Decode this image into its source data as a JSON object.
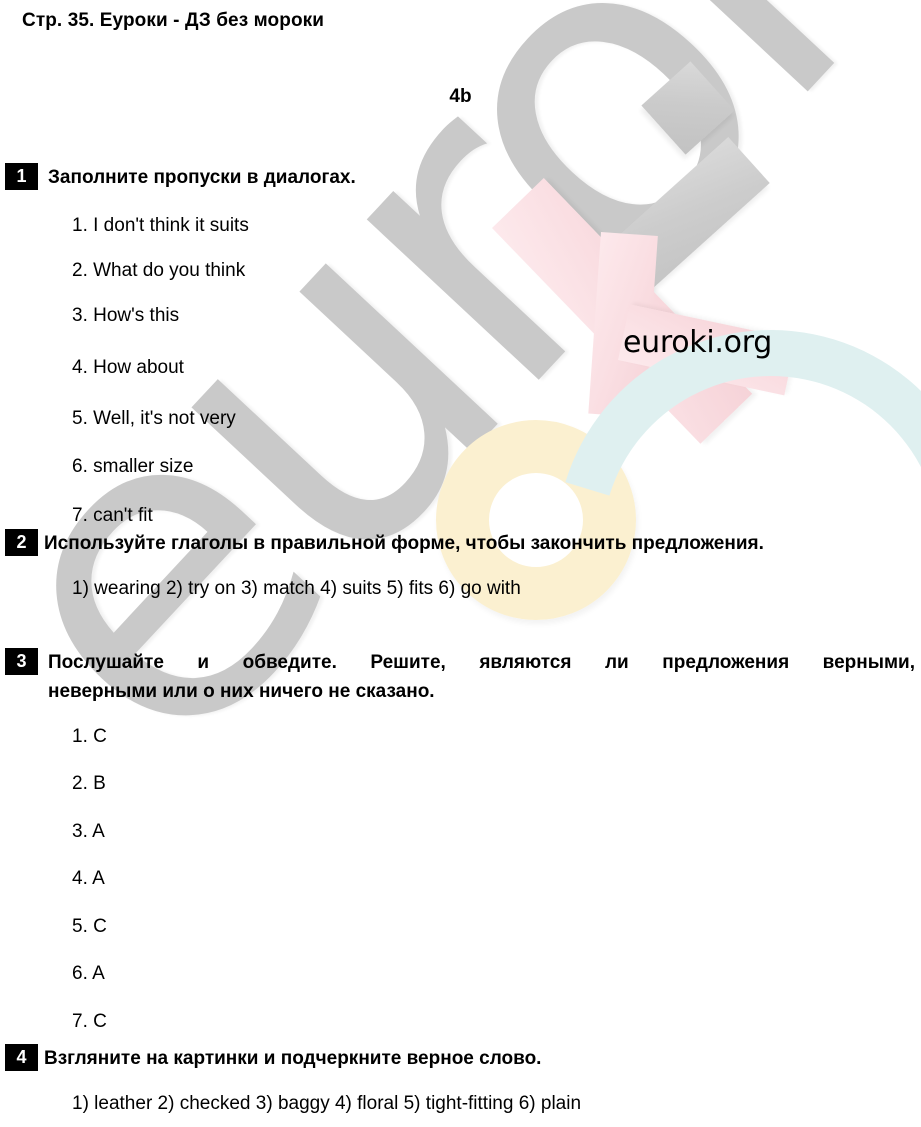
{
  "page": {
    "header": "Стр. 35. Еуроки - ДЗ без мороки",
    "unit_title": "4b"
  },
  "watermark": {
    "big_text": "euroki",
    "site_text": "euroki.org",
    "colors": {
      "gray": "#c9c9c9",
      "pink": "#fadfe3",
      "cream": "#fbf0d0",
      "blue": "#dff0f0",
      "text": "#000000"
    }
  },
  "exercises": [
    {
      "number": "1",
      "title": "Заполните пропуски в диалогах.",
      "answers": [
        "1. I don't think it suits",
        "2. What do you think",
        "3. How's this",
        "4. How about",
        "5. Well, it's not very",
        "6. smaller size",
        "7. can't fit"
      ]
    },
    {
      "number": "2",
      "title": "Используйте глаголы в правильной форме, чтобы закончить предложения.",
      "answer_line": "1) wearing 2) try on 3) match 4) suits 5) fits 6) go with"
    },
    {
      "number": "3",
      "title_line1": "Послушайте и обведите. Решите, являются ли предложения верными,",
      "title_line2": "неверными или о них ничего не сказано.",
      "answers": [
        "1. C",
        "2. B",
        "3. A",
        "4. A",
        "5. C",
        "6. A",
        "7. C"
      ]
    },
    {
      "number": "4",
      "title": "Взгляните на картинки и подчеркните верное слово.",
      "answer_line": "1) leather 2) checked 3) baggy 4) floral 5) tight-fitting 6) plain"
    }
  ]
}
